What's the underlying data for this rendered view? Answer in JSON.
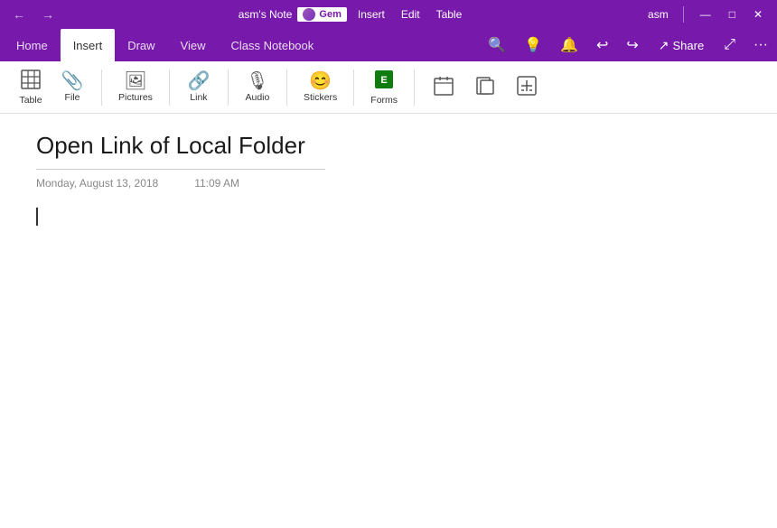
{
  "titleBar": {
    "backLabel": "←",
    "forwardLabel": "→",
    "noteTitle": "asm's Note",
    "gem": {
      "label": "Gem"
    },
    "menuItems": [
      "Insert",
      "Edit",
      "Table"
    ],
    "userName": "asm",
    "minimizeLabel": "—",
    "maximizeLabel": "□",
    "closeLabel": "✕"
  },
  "ribbonTabs": {
    "tabs": [
      "Home",
      "Insert",
      "Draw",
      "View",
      "Class Notebook"
    ],
    "activeTab": "Insert",
    "rightButtons": {
      "searchLabel": "🔍",
      "lightbulbLabel": "💡",
      "bellLabel": "🔔",
      "undoLabel": "↩",
      "redoLabel": "↪",
      "shareLabel": "Share",
      "shareIcon": "↗",
      "expandLabel": "⤢",
      "moreLabel": "···"
    }
  },
  "toolbar": {
    "groups": [
      {
        "items": [
          {
            "name": "table",
            "icon": "⊞",
            "label": "Table"
          },
          {
            "name": "file",
            "icon": "📎",
            "label": "File"
          }
        ]
      },
      {
        "items": [
          {
            "name": "pictures",
            "icon": "🖼",
            "label": "Pictures"
          }
        ]
      },
      {
        "items": [
          {
            "name": "link",
            "icon": "🔗",
            "label": "Link"
          }
        ]
      },
      {
        "items": [
          {
            "name": "audio",
            "icon": "🎙",
            "label": "Audio"
          }
        ]
      },
      {
        "items": [
          {
            "name": "stickers",
            "icon": "😊",
            "label": "Stickers"
          }
        ]
      },
      {
        "items": [
          {
            "name": "forms",
            "icon": "📋",
            "label": "Forms"
          }
        ]
      },
      {
        "items": [
          {
            "name": "calendar",
            "icon": "📅",
            "label": ""
          },
          {
            "name": "pages",
            "icon": "⧉",
            "label": ""
          },
          {
            "name": "math",
            "icon": "⊞",
            "label": ""
          }
        ]
      }
    ]
  },
  "note": {
    "title": "Open Link of Local Folder",
    "date": "Monday, August 13, 2018",
    "time": "11:09 AM"
  }
}
